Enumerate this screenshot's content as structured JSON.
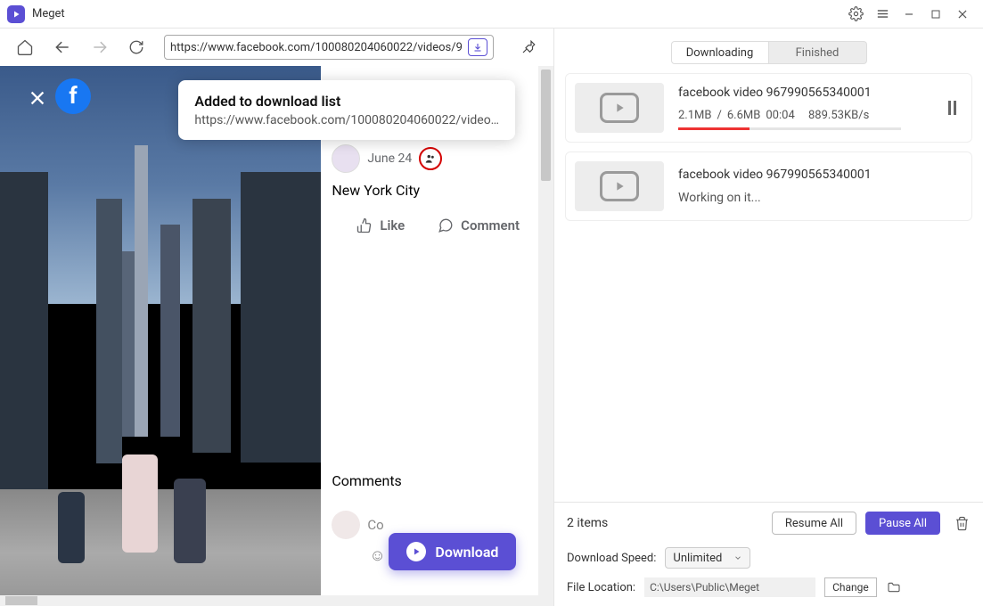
{
  "app": {
    "title": "Meget"
  },
  "browser": {
    "url": "https://www.facebook.com/100080204060022/videos/9"
  },
  "toast": {
    "title": "Added to download list",
    "url": "https://www.facebook.com/100080204060022/videos/96..."
  },
  "post": {
    "date": "June 24",
    "title": "New York City",
    "like": "Like",
    "comment": "Comment",
    "comments_label": "Comments",
    "comment_placeholder": "Co"
  },
  "download_button": "Download",
  "tabs": {
    "downloading": "Downloading",
    "finished": "Finished"
  },
  "downloads": [
    {
      "name": "facebook video 967990565340001",
      "done": "2.1MB",
      "total": "6.6MB",
      "eta": "00:04",
      "speed": "889.53KB/s"
    },
    {
      "name": "facebook video 967990565340001",
      "status": "Working on it..."
    }
  ],
  "footer": {
    "count": "2 items",
    "resume": "Resume All",
    "pause": "Pause All",
    "speed_label": "Download Speed:",
    "speed_value": "Unlimited",
    "location_label": "File Location:",
    "path": "C:\\Users\\Public\\Meget",
    "change": "Change"
  }
}
